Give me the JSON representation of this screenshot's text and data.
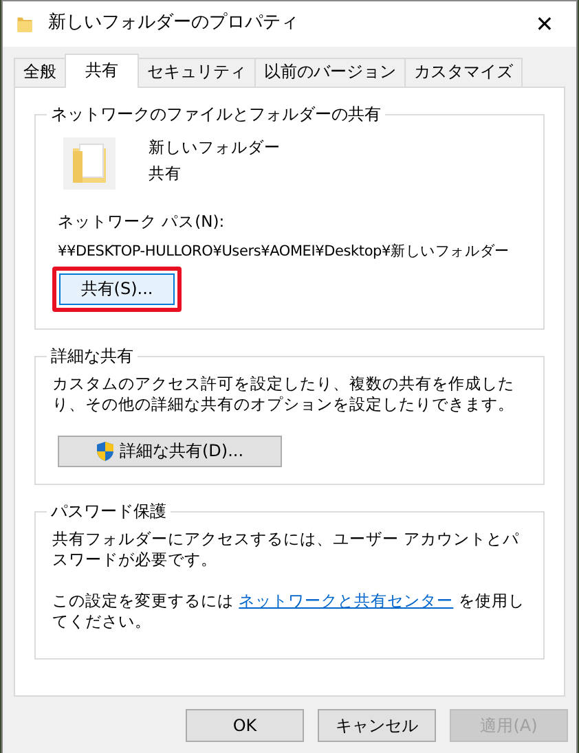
{
  "window": {
    "title": "新しいフォルダーのプロパティ",
    "close": "✕"
  },
  "tabs": [
    {
      "label": "全般",
      "selected": false
    },
    {
      "label": "共有",
      "selected": true
    },
    {
      "label": "セキュリティ",
      "selected": false
    },
    {
      "label": "以前のバージョン",
      "selected": false
    },
    {
      "label": "カスタマイズ",
      "selected": false
    }
  ],
  "network_sharing": {
    "legend": "ネットワークのファイルとフォルダーの共有",
    "folder_name": "新しいフォルダー",
    "folder_status": "共有",
    "path_label": "ネットワーク パス(N):",
    "path": "¥¥DESKTOP-HULLORO¥Users¥AOMEI¥Desktop¥新しいフォルダー",
    "share_button": {
      "label": "共有(S)...",
      "highlighted": true
    }
  },
  "advanced_sharing": {
    "legend": "詳細な共有",
    "description": "カスタムのアクセス許可を設定したり、複数の共有を作成したり、その他の詳細な共有のオプションを設定したりできます。",
    "button": "詳細な共有(D)..."
  },
  "password_protection": {
    "legend": "パスワード保護",
    "description": "共有フォルダーにアクセスするには、ユーザー アカウントとパスワードが必要です。",
    "note_before": "この設定を変更するには ",
    "note_link": "ネットワークと共有センター",
    "note_after": " を使用してください。"
  },
  "buttons": [
    {
      "label": "OK",
      "disabled": false
    },
    {
      "label": "キャンセル",
      "disabled": false
    },
    {
      "label": "適用(A)",
      "disabled": true
    }
  ]
}
